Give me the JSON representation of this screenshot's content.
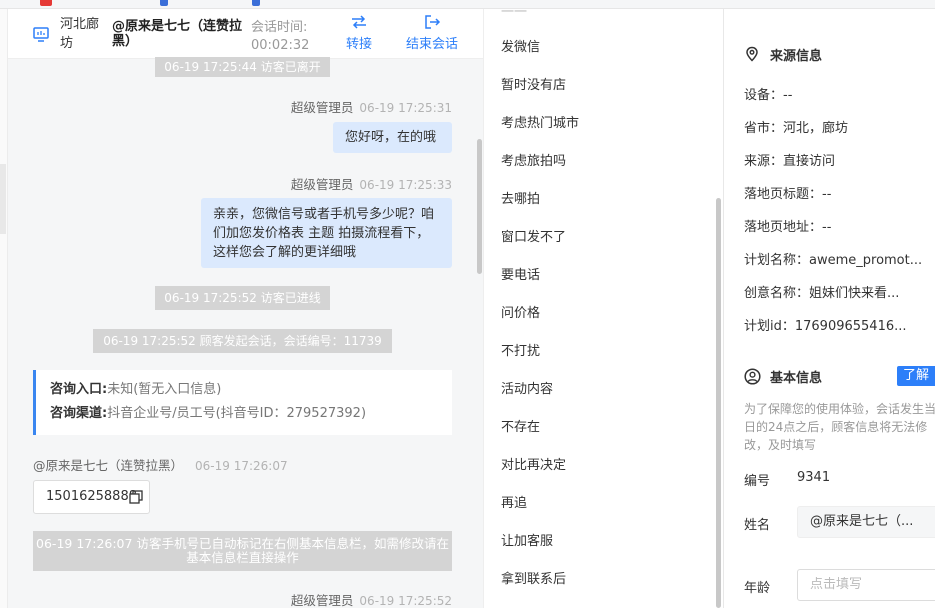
{
  "header": {
    "location": "河北廊坊",
    "visitor_name": "@原来是七七（连赞拉黑）",
    "time_label": "会话时间:",
    "time_value": "00:02:32",
    "transfer_label": "转接",
    "end_label": "结束会话"
  },
  "messages": {
    "sys_left": "06-19 17:25:44 访客已离开",
    "agent1_name": "超级管理员",
    "agent1_time": "06-19 17:25:31",
    "agent1_text": "您好呀，在的哦",
    "agent2_name": "超级管理员",
    "agent2_time": "06-19 17:25:33",
    "agent2_text": "亲亲，您微信号或者手机号多少呢？咱们加您发价格表 主题 拍摄流程看下，这样您会了解的更详细哦",
    "sys_enter": "06-19 17:25:52 访客已进线",
    "sys_session": "06-19 17:25:52 顾客发起会话，会话编号：11739",
    "entry_label": "咨询入口:",
    "entry_value": "未知(暂无入口信息)",
    "channel_label": "咨询渠道:",
    "channel_value": "抖音企业号/员工号(抖音号ID：279527392)",
    "visitor_name": "@原来是七七（连赞拉黑）",
    "visitor_time": "06-19 17:26:07",
    "visitor_text": "15016258888",
    "sys_auto": "06-19 17:26:07 访客手机号已自动标记在右侧基本信息栏，如需修改请在基本信息栏直接操作",
    "agent3_name": "超级管理员",
    "agent3_time": "06-19 17:25:52"
  },
  "quick_replies": [
    "发微信",
    "暂时没有店",
    "考虑热门城市",
    "考虑旅拍吗",
    "去哪拍",
    "窗口发不了",
    "要电话",
    "问价格",
    "不打扰",
    "活动内容",
    "不存在",
    "对比再决定",
    "再追",
    "让加客服",
    "拿到联系后"
  ],
  "source_info": {
    "title": "来源信息",
    "device": "设备：--",
    "province": "省市：河北，廊坊",
    "source": "来源：直接访问",
    "landing_title": "落地页标题：--",
    "landing_url": "落地页地址：--",
    "plan_name": "计划名称：aweme_promot...",
    "creative_name": "创意名称：姐妹们快来看...",
    "plan_id": "计划id：176909655416..."
  },
  "basic_info": {
    "title": "基本信息",
    "learn_more": "了解",
    "note": "为了保障您的使用体验，会话发生当日的24点之后，顾客信息将无法修改，及时填写",
    "id_label": "编号",
    "id_value": "9341",
    "name_label": "姓名",
    "name_value": "@原来是七七（...",
    "age_label": "年龄",
    "age_placeholder": "点击填写"
  },
  "colors": {
    "accent": "#2d7ff9",
    "bubble_out": "#dbe9fd",
    "system": "#d4d4d4"
  }
}
